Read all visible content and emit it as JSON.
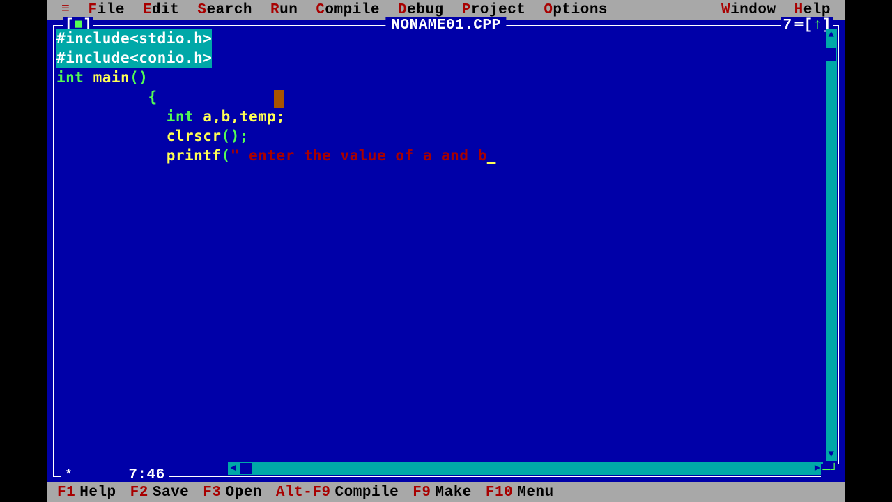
{
  "menu": {
    "items": [
      "File",
      "Edit",
      "Search",
      "Run",
      "Compile",
      "Debug",
      "Project",
      "Options"
    ],
    "right": [
      "Window",
      "Help"
    ]
  },
  "window": {
    "title": "NONAME01.CPP",
    "number": "7",
    "cursor_pos": "7:46"
  },
  "code": {
    "l1": "#include<stdio.h>",
    "l2": "#include<conio.h>",
    "l3_type": "int ",
    "l3_name": "main",
    "l3_paren": "()",
    "l4_brace": "{",
    "l5_type": "int ",
    "l5_vars": "a,b,temp",
    "l5_semi": ";",
    "l6_call": "clrscr",
    "l6_paren": "();",
    "l7_call": "printf",
    "l7_open": "(",
    "l7_quote": "\"",
    "l7_str": " enter the value of a and b",
    "l7_cursor": "_"
  },
  "status": {
    "items": [
      {
        "key": "F1",
        "label": "Help"
      },
      {
        "key": "F2",
        "label": "Save"
      },
      {
        "key": "F3",
        "label": "Open"
      },
      {
        "key": "Alt-F9",
        "label": "Compile"
      },
      {
        "key": "F9",
        "label": "Make"
      },
      {
        "key": "F10",
        "label": "Menu"
      }
    ]
  }
}
